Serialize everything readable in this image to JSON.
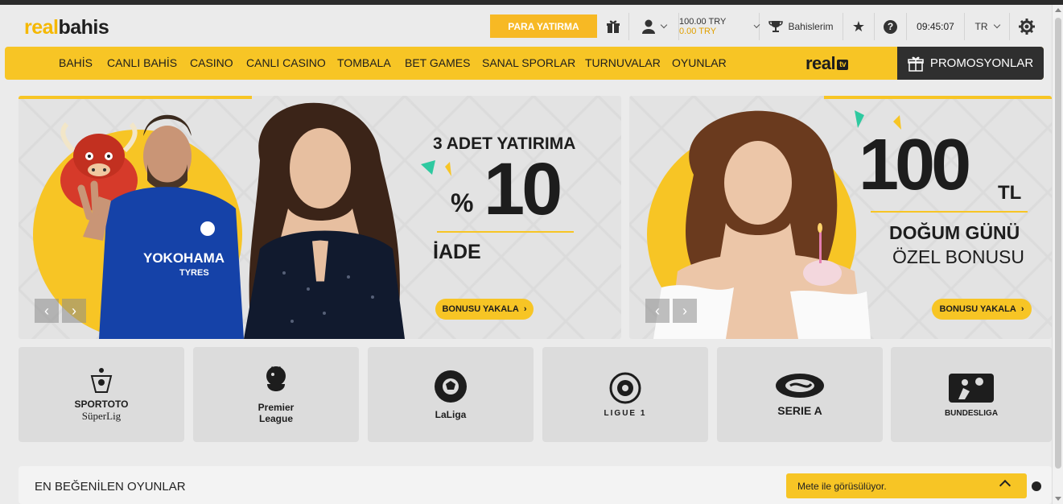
{
  "header": {
    "logo_part1": "real",
    "logo_part2": "bahis",
    "deposit_button": "PARA YATIRMA",
    "balance_main": "100.00 TRY",
    "balance_bonus": "0.00 TRY",
    "bets_label": "Bahislerim",
    "clock": "09:45:07",
    "language": "TR"
  },
  "nav": {
    "items": [
      "BAHİS",
      "CANLI BAHİS",
      "CASINO",
      "CANLI CASINO",
      "TOMBALA",
      "BET GAMES",
      "SANAL SPORLAR",
      "TURNUVALAR",
      "OYUNLAR"
    ],
    "tv_logo": "real",
    "tv_badge": "tv",
    "promo_label": "PROMOSYONLAR"
  },
  "banners": {
    "left": {
      "line1": "3 ADET YATIRIMA",
      "percent_sign": "%",
      "percent_value": "10",
      "line3": "İADE",
      "cta": "BONUSU YAKALA",
      "shirt_text1": "YOKOHAMA",
      "shirt_text2": "TYRES"
    },
    "right": {
      "amount": "100",
      "currency": "TL",
      "line2": "DOĞUM GÜNÜ",
      "line3": "ÖZEL BONUSU",
      "cta": "BONUSU YAKALA"
    }
  },
  "leagues": [
    {
      "name": "SPORTOTO",
      "sub": "SüperLig"
    },
    {
      "name": "Premier",
      "sub": "League"
    },
    {
      "name": "LaLiga",
      "sub": ""
    },
    {
      "name": "LIGUE 1",
      "sub": ""
    },
    {
      "name": "SERIE A",
      "sub": ""
    },
    {
      "name": "BUNDESLIGA",
      "sub": ""
    }
  ],
  "games": {
    "title": "EN BEĞENİLEN OYUNLAR"
  },
  "chat": {
    "status": "Mete ile görüsülüyor."
  },
  "colors": {
    "brand_yellow": "#f7c525",
    "dark": "#2f2f2f"
  }
}
